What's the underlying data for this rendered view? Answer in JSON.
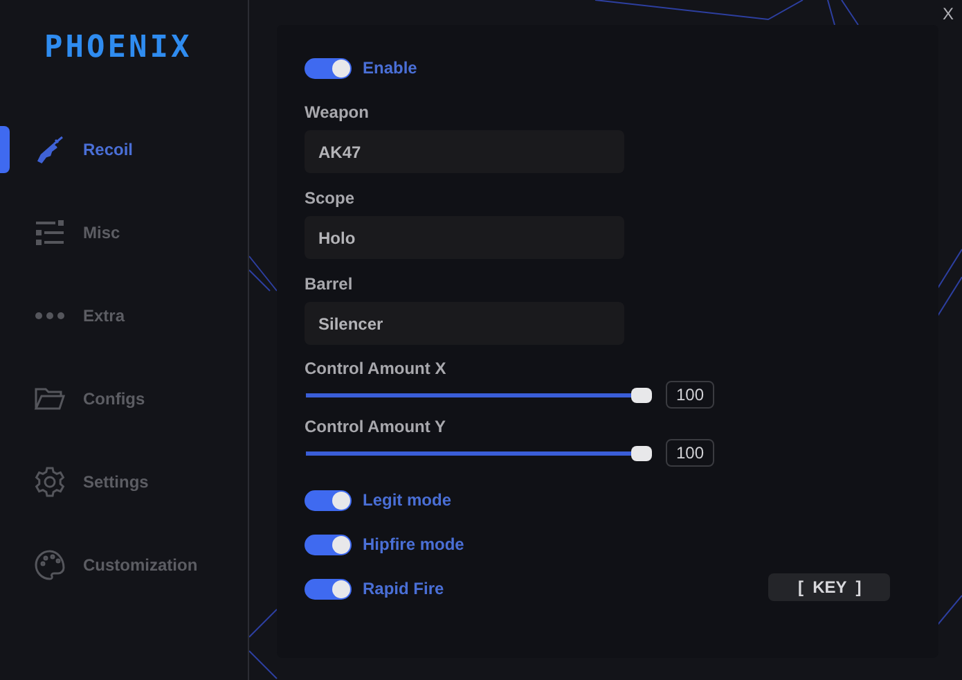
{
  "logo": "PHOENIX",
  "close": "X",
  "sidebar": {
    "items": [
      {
        "label": "Recoil",
        "selected": true
      },
      {
        "label": "Misc",
        "selected": false
      },
      {
        "label": "Extra",
        "selected": false
      },
      {
        "label": "Configs",
        "selected": false
      },
      {
        "label": "Settings",
        "selected": false
      },
      {
        "label": "Customization",
        "selected": false
      }
    ]
  },
  "enable": {
    "label": "Enable",
    "on": true
  },
  "selects": [
    {
      "label": "Weapon",
      "value": "AK47"
    },
    {
      "label": "Scope",
      "value": "Holo"
    },
    {
      "label": "Barrel",
      "value": "Silencer"
    }
  ],
  "sliders": [
    {
      "label": "Control Amount X",
      "level": 1,
      "reading": "100"
    },
    {
      "label": "Control Amount Y",
      "level": 1,
      "reading": "100"
    }
  ],
  "toggles": [
    {
      "label": "Legit mode",
      "on": true
    },
    {
      "label": "Hipfire mode",
      "on": true
    },
    {
      "label": "Rapid Fire",
      "on": true
    }
  ],
  "key_button": "[  KEY  ]"
}
